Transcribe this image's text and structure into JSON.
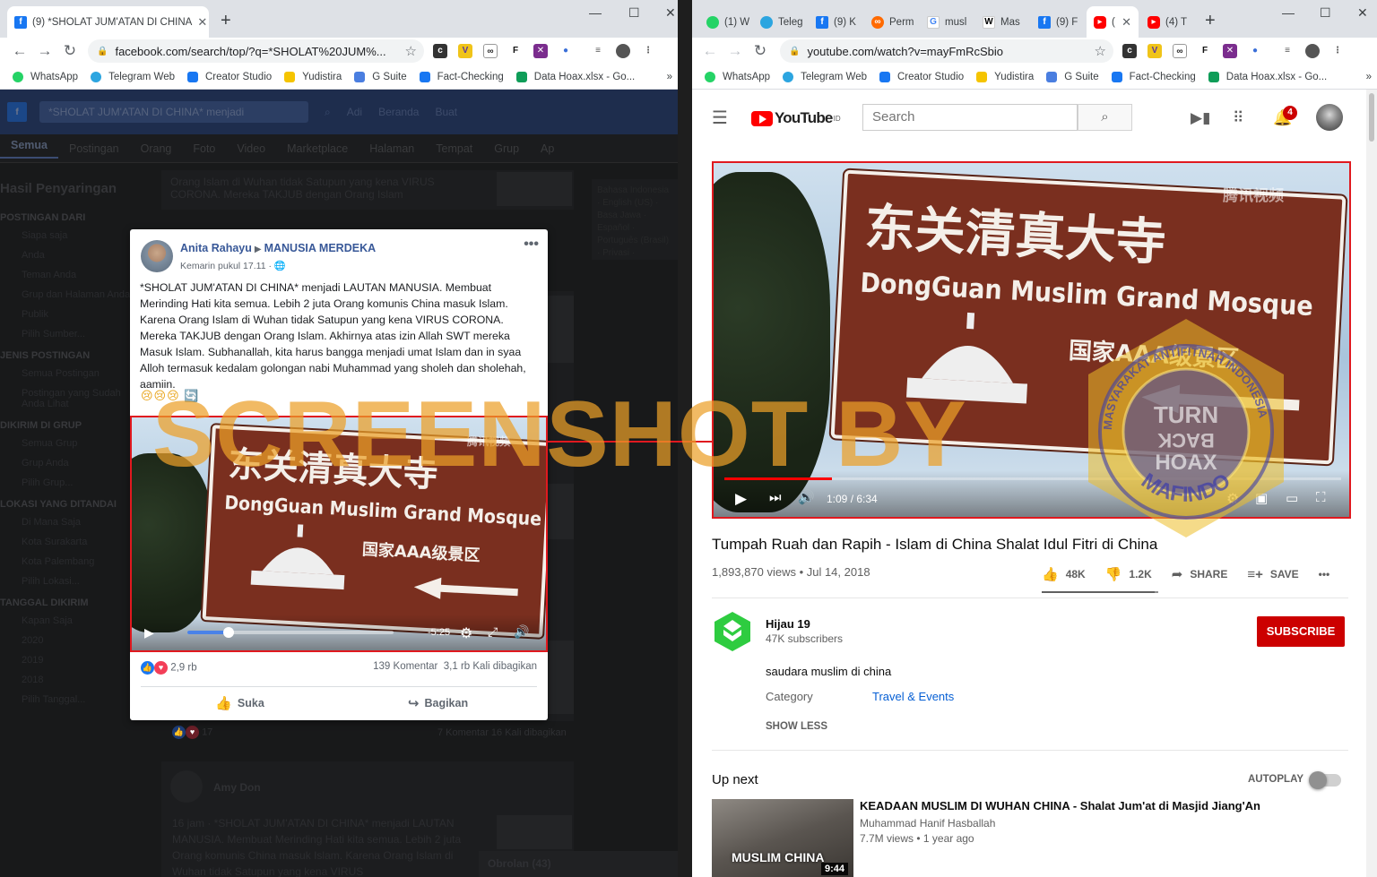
{
  "left_browser": {
    "tab_title": "(9) *SHOLAT JUM'ATAN DI CHINA",
    "new_tab": "+",
    "url": "facebook.com/search/top/?q=*SHOLAT%20JUM%...",
    "bookmarks": [
      "WhatsApp",
      "Telegram Web",
      "Creator Studio",
      "Yudistira",
      "G Suite",
      "Fact-Checking",
      "Data Hoax.xlsx - Go..."
    ],
    "more": "»"
  },
  "right_browser": {
    "tabs": [
      "(1) W",
      "Teleg",
      "(9) K",
      "Perm",
      "musl",
      "Mas",
      "(9) F",
      "(",
      "(4) T"
    ],
    "new_tab": "+",
    "url": "youtube.com/watch?v=mayFmRcSbio",
    "bookmarks": [
      "WhatsApp",
      "Telegram Web",
      "Creator Studio",
      "Yudistira",
      "G Suite",
      "Fact-Checking",
      "Data Hoax.xlsx - Go..."
    ],
    "more": "»"
  },
  "facebook": {
    "search_value": "*SHOLAT JUM'ATAN DI  CHINA* menjadi",
    "top_links": [
      "Adi",
      "Beranda",
      "Buat"
    ],
    "tabs": [
      "Semua",
      "Postingan",
      "Orang",
      "Foto",
      "Video",
      "Marketplace",
      "Halaman",
      "Tempat",
      "Grup",
      "Ap"
    ],
    "filters_title": "Hasil Penyaringan",
    "filter_groups": [
      {
        "head": "POSTINGAN DARI",
        "items": [
          "Siapa saja",
          "Anda",
          "Teman Anda",
          "Grup dan Halaman Anda",
          "Publik",
          "Pilih Sumber..."
        ]
      },
      {
        "head": "JENIS POSTINGAN",
        "items": [
          "Semua Postingan",
          "Postingan yang Sudah Anda Lihat"
        ]
      },
      {
        "head": "DIKIRIM DI GRUP",
        "items": [
          "Semua Grup",
          "Grup Anda",
          "Pilih Grup..."
        ]
      },
      {
        "head": "LOKASI YANG DITANDAI",
        "items": [
          "Di Mana Saja",
          "Kota Surakarta",
          "Kota Palembang",
          "Pilih Lokasi..."
        ]
      },
      {
        "head": "TANGGAL DIKIRIM",
        "items": [
          "Kapan Saja",
          "2020",
          "2019",
          "2018",
          "Pilih Tanggal..."
        ]
      }
    ],
    "bg_post_text": "Orang Islam di Wuhan tidak Satupun yang kena VIRUS CORONA. Mereka TAKJUB dengan Orang Islam",
    "bg_post2_author": "Amy Don",
    "bg_post2_text": "16 jam · *SHOLAT JUM'ATAN DI CHINA* menjadi LAUTAN MANUSIA. Membuat Merinding Hati kita semua. Lebih 2 juta Orang komunis China masuk Islam. Karena Orang Islam di Wuhan tidak Satupun yang kena VIRUS",
    "bg_post_stats": "7 Komentar  16 Kali dibagikan",
    "bg_reactions": "17",
    "chat_label": "Obrolan (43)",
    "side_text": [
      "Bahasa Indonesia · English (US) · Basa Jawa · Español · Português (Brasil) · Privasi · Ketentuan · Iklan · Pilihan Iklan · Cookie · Lainnya · Facebook © 2020"
    ],
    "post": {
      "author": "Anita Rahayu",
      "group": "MANUSIA MERDEKA",
      "time": "Kemarin pukul 17.11",
      "text": "*SHOLAT JUM'ATAN DI CHINA* menjadi LAUTAN MANUSIA. Membuat Merinding Hati kita semua. Lebih 2 juta Orang komunis China masuk Islam. Karena Orang Islam di Wuhan tidak Satupun yang kena VIRUS CORONA. Mereka TAKJUB dengan Orang Islam. Akhirnya atas izin Allah SWT mereka Masuk Islam. Subhanallah, kita harus bangga menjadi umat Islam dan in syaa Alloh termasuk kedalam golongan nabi Muhammad yang sholeh dan sholehah, aamiin.",
      "emoji": "😢😢😢 🔄",
      "video_remaining": "-5:25",
      "video_progress": 0.2,
      "reactions": "2,9 rb",
      "comments": "139 Komentar",
      "shares": "3,1 rb Kali dibagikan",
      "like_label": "Suka",
      "share_label": "Bagikan"
    }
  },
  "video_sign": {
    "chinese": "东关清真大寺",
    "english": "DongGuan Muslim Grand Mosque",
    "grade": "国家AAA级景区",
    "logo": "腾讯视频"
  },
  "youtube": {
    "logo_text": "YouTube",
    "logo_region": "ID",
    "search_placeholder": "Search",
    "notifications": "4",
    "player_time": "1:09 / 6:34",
    "player_progress": 0.175,
    "title": "Tumpah Ruah dan Rapih - Islam di China Shalat Idul Fitri di China",
    "meta": "1,893,870 views • Jul 14, 2018",
    "likes": "48K",
    "dislikes": "1.2K",
    "share": "SHARE",
    "save": "SAVE",
    "like_ratio": 0.97,
    "channel_name": "Hijau 19",
    "channel_subs": "47K subscribers",
    "subscribe": "SUBSCRIBE",
    "description": "saudara muslim di china",
    "category_label": "Category",
    "category_value": "Travel & Events",
    "show_less": "SHOW LESS",
    "up_next": "Up next",
    "autoplay": "AUTOPLAY",
    "autoplay_on": false,
    "next_title": "KEADAAN MUSLIM DI WUHAN CHINA - Shalat Jum'at di Masjid Jiang'An",
    "next_channel": "Muhammad Hanif Hasballah",
    "next_meta": "7.7M views • 1 year ago",
    "next_thumb_text": "MUSLIM CHINA",
    "next_duration": "9:44"
  },
  "watermark": {
    "text": "SCREENSHOT BY",
    "stamp_top": "MASYARAKAT ANTIFITNAH INDONESIA",
    "stamp_mid": [
      "TURN",
      "BACK",
      "HOAX"
    ],
    "stamp_bottom": "MAFINDO"
  },
  "colors": {
    "highlight_red": "#e0191f",
    "fb_blue": "#1877f2",
    "yt_red": "#ff0000",
    "watermark_orange": "#eca028"
  }
}
